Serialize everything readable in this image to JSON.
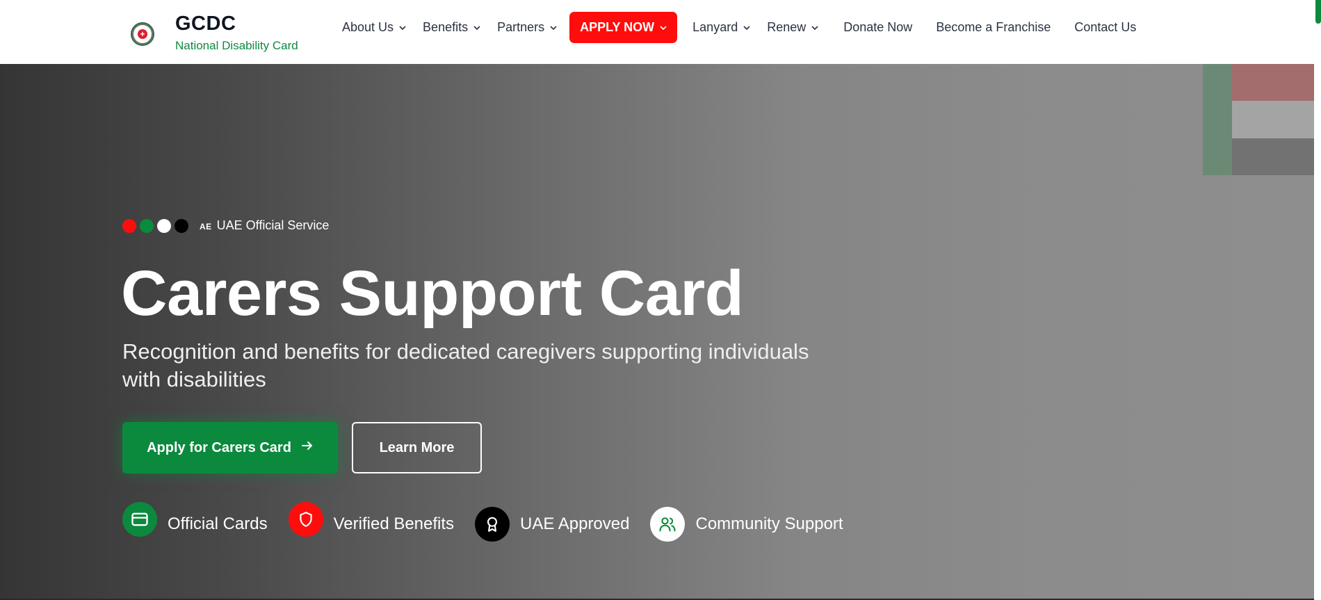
{
  "brand": {
    "title": "GCDC",
    "subtitle": "National Disability Card",
    "logo_icon": "gcdc-emblem-icon"
  },
  "nav": {
    "items": [
      {
        "label": "About Us",
        "has_dropdown": true
      },
      {
        "label": "Benefits",
        "has_dropdown": true
      },
      {
        "label": "Partners",
        "has_dropdown": true
      },
      {
        "label": "APPLY NOW",
        "has_dropdown": true,
        "highlight": true
      },
      {
        "label": "Lanyard",
        "has_dropdown": true
      },
      {
        "label": "Renew",
        "has_dropdown": true
      },
      {
        "label": "Donate Now",
        "has_dropdown": false
      },
      {
        "label": "Become a Franchise",
        "has_dropdown": false
      },
      {
        "label": "Contact Us",
        "has_dropdown": false
      }
    ]
  },
  "hero": {
    "badge_prefix": "AE",
    "badge_text": "UAE Official Service",
    "title": "Carers Support Card",
    "subtitle": "Recognition and benefits for dedicated caregivers supporting individuals with disabilities",
    "primary_button": "Apply for Carers Card",
    "secondary_button": "Learn More",
    "features": [
      {
        "label": "Official Cards",
        "icon": "credit-card-icon"
      },
      {
        "label": "Verified Benefits",
        "icon": "shield-icon"
      },
      {
        "label": "UAE Approved",
        "icon": "award-icon"
      },
      {
        "label": "Community Support",
        "icon": "users-icon"
      }
    ]
  },
  "colors": {
    "accent_green": "#0b8a3e",
    "accent_red": "#ff0d0d",
    "nav_text": "#2a3140",
    "brand_title": "#0e1420"
  }
}
